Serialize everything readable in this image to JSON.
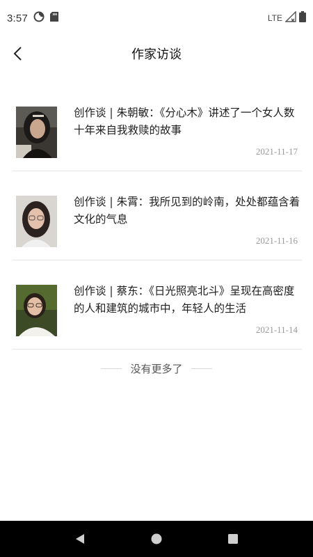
{
  "status_bar": {
    "time": "3:57",
    "network": "LTE",
    "icons": [
      "data-saver-icon",
      "sd-card-icon",
      "signal-icon",
      "battery-icon"
    ]
  },
  "header": {
    "title": "作家访谈",
    "back_icon": "back-chevron-icon"
  },
  "articles": [
    {
      "title": "创作谈 | 朱朝敏：《分心木》讲述了一个女人数十年来自我救赎的故事",
      "date": "2021-11-17",
      "thumbnail": "author-photo"
    },
    {
      "title": "创作谈 | 朱霄：我所见到的岭南，处处都蕴含着文化的气息",
      "date": "2021-11-16",
      "thumbnail": "author-photo"
    },
    {
      "title": "创作谈 | 蔡东：《日光照亮北斗》呈现在高密度的人和建筑的城市中，年轻人的生活",
      "date": "2021-11-14",
      "thumbnail": "author-photo"
    }
  ],
  "footer": {
    "no_more_text": "没有更多了"
  },
  "nav_bar": {
    "buttons": [
      "back-triangle-icon",
      "home-circle-icon",
      "recents-square-icon"
    ]
  },
  "colors": {
    "background": "#ffffff",
    "title_text": "#111111",
    "date_text": "#9a9a9a",
    "divider": "#e6e6e6",
    "nav_bar": "#000000"
  }
}
